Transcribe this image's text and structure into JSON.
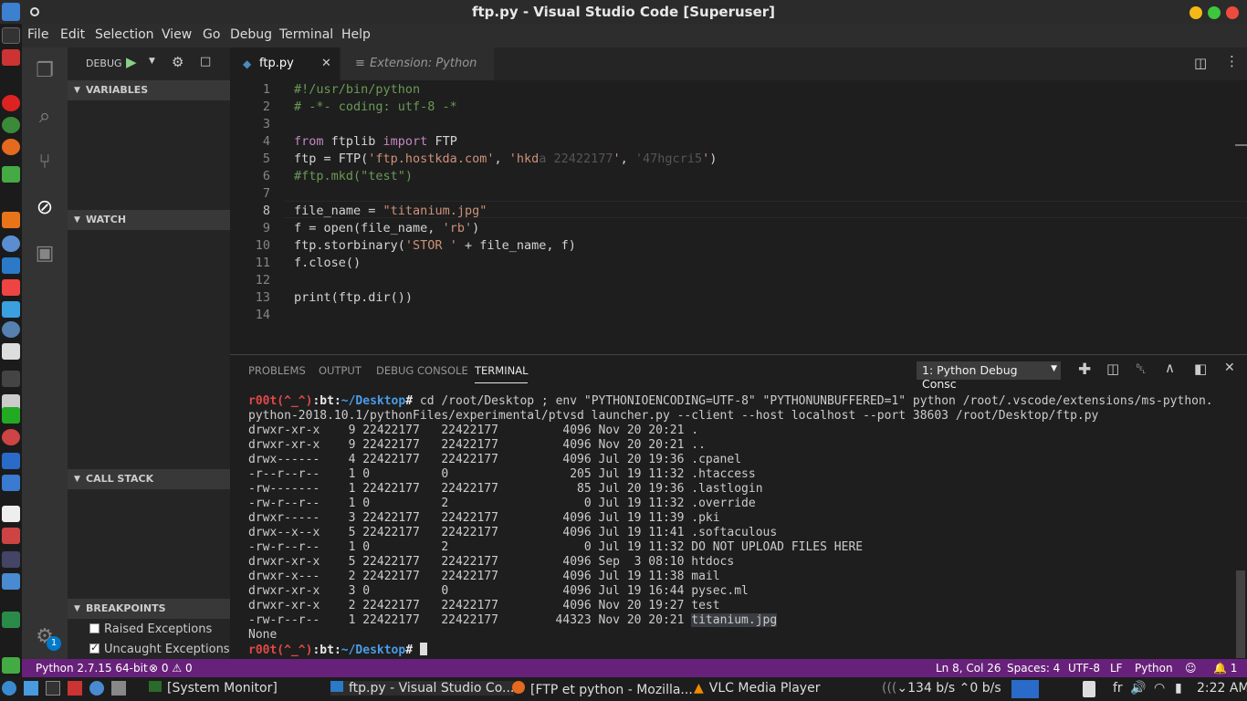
{
  "window": {
    "title": "ftp.py - Visual Studio Code [Superuser]"
  },
  "menu": [
    "File",
    "Edit",
    "Selection",
    "View",
    "Go",
    "Debug",
    "Terminal",
    "Help"
  ],
  "debug": {
    "label": "DEBUG"
  },
  "sidebar": {
    "variables": "VARIABLES",
    "watch": "WATCH",
    "call_stack": "CALL STACK",
    "breakpoints": "BREAKPOINTS",
    "bp_items": [
      {
        "label": "Raised Exceptions",
        "checked": false
      },
      {
        "label": "Uncaught Exceptions",
        "checked": true
      }
    ]
  },
  "activity_badge": "1",
  "tabs": [
    {
      "label": "ftp.py",
      "active": true
    },
    {
      "label": "Extension: Python",
      "active": false
    }
  ],
  "editor": {
    "line_numbers": [
      "1",
      "2",
      "3",
      "4",
      "5",
      "6",
      "7",
      "8",
      "9",
      "10",
      "11",
      "12",
      "13",
      "14"
    ],
    "current_line": 8
  },
  "panel": {
    "tabs": [
      "PROBLEMS",
      "OUTPUT",
      "DEBUG CONSOLE",
      "TERMINAL"
    ],
    "active_tab": "TERMINAL",
    "terminal_select": "1: Python Debug Consc",
    "prompt": {
      "user": "r00t(^_^)",
      "host": "bt",
      "path": "~/Desktop"
    },
    "command_line1": " cd /root/Desktop ; env \"PYTHONIOENCODING=UTF-8\" \"PYTHONUNBUFFERED=1\" python /root/.vscode/extensions/ms-python.",
    "command_line2": "python-2018.10.1/pythonFiles/experimental/ptvsd launcher.py --client --host localhost --port 38603 /root/Desktop/ftp.py",
    "listing": [
      "drwxr-xr-x    9 22422177   22422177         4096 Nov 20 20:21 .",
      "drwxr-xr-x    9 22422177   22422177         4096 Nov 20 20:21 ..",
      "drwx------    4 22422177   22422177         4096 Jul 20 19:36 .cpanel",
      "-r--r--r--    1 0          0                 205 Jul 19 11:32 .htaccess",
      "-rw-------    1 22422177   22422177           85 Jul 20 19:36 .lastlogin",
      "-rw-r--r--    1 0          2                   0 Jul 19 11:32 .override",
      "drwxr-----    3 22422177   22422177         4096 Jul 19 11:39 .pki",
      "drwx--x--x    5 22422177   22422177         4096 Jul 19 11:41 .softaculous",
      "-rw-r--r--    1 0          2                   0 Jul 19 11:32 DO NOT UPLOAD FILES HERE",
      "drwxr-xr-x    5 22422177   22422177         4096 Sep  3 08:10 htdocs",
      "drwxr-x---    2 22422177   22422177         4096 Jul 19 11:38 mail",
      "drwxr-xr-x    3 0          0                4096 Jul 19 16:44 pysec.ml",
      "drwxr-xr-x    2 22422177   22422177         4096 Nov 20 19:27 test"
    ],
    "last_row_prefix": "-rw-r--r--    1 22422177   22422177        44323 Nov 20 20:21 ",
    "last_row_file": "titanium.jpg",
    "none_line": "None"
  },
  "status": {
    "python": "Python 2.7.15 64-bit",
    "errors": "0",
    "warnings": "0",
    "position": "Ln 8, Col 26",
    "spaces": "Spaces: 4",
    "encoding": "UTF-8",
    "eol": "LF",
    "language": "Python",
    "bell": "1"
  },
  "taskbar": {
    "items": [
      "[System Monitor]",
      "ftp.py - Visual Studio Co...",
      "[FTP et python - Mozilla...",
      "VLC Media Player"
    ],
    "net": "134 b/s",
    "net2": "0 b/s",
    "lang": "fr",
    "clock": "2:22 AM"
  },
  "colors": {
    "statusbar": "#68217a",
    "accent": "#007acc"
  }
}
